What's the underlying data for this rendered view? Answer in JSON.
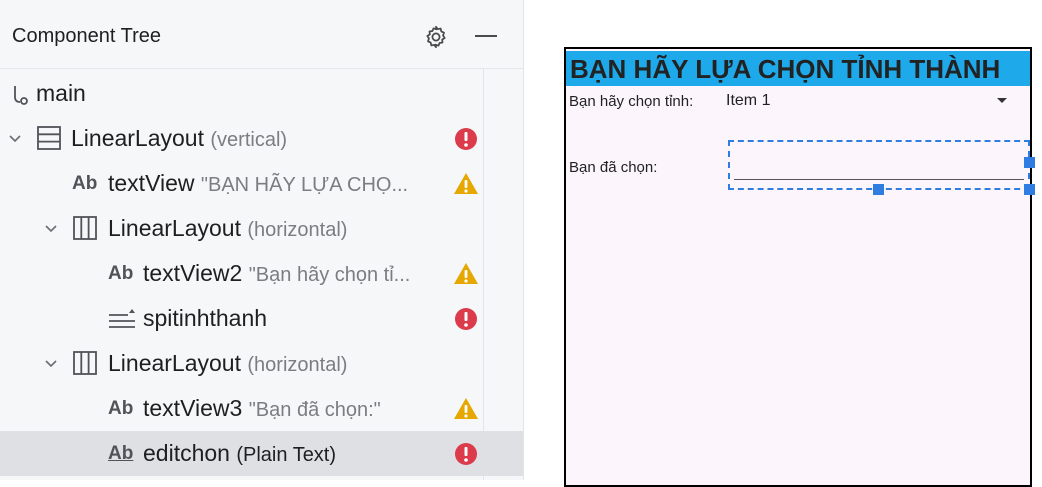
{
  "tree": {
    "title": "Component Tree",
    "rows": [
      {
        "label": "main",
        "extra": ""
      },
      {
        "label": "LinearLayout",
        "extra": "(vertical)"
      },
      {
        "prefix": "Ab",
        "label": "textView",
        "extra": "\"BẠN HÃY LỰA CHỌ...",
        "status": "warning"
      },
      {
        "label": "LinearLayout",
        "extra": "(horizontal)"
      },
      {
        "prefix": "Ab",
        "label": "textView2",
        "extra": "\"Bạn hãy chọn tỉ...",
        "status": "warning"
      },
      {
        "label": "spitinhthanh",
        "extra": "",
        "status": "error"
      },
      {
        "label": "LinearLayout",
        "extra": "(horizontal)"
      },
      {
        "prefix": "Ab",
        "label": "textView3",
        "extra": "\"Bạn đã chọn:\"",
        "status": "warning"
      },
      {
        "prefix": "Ab",
        "label": "editchon",
        "extra": "(Plain Text)",
        "status": "error"
      }
    ]
  },
  "preview": {
    "title": "BẠN HÃY LỰA CHỌN TỈNH THÀNH",
    "province_label": "Bạn hãy chọn tỉnh:",
    "spinner_value": "Item 1",
    "chosen_label": "Bạn đã chọn:"
  },
  "colors": {
    "accent": "#1ea9ea",
    "error": "#db3b4b",
    "warning": "#e6a700",
    "selection": "#2f7de1"
  }
}
